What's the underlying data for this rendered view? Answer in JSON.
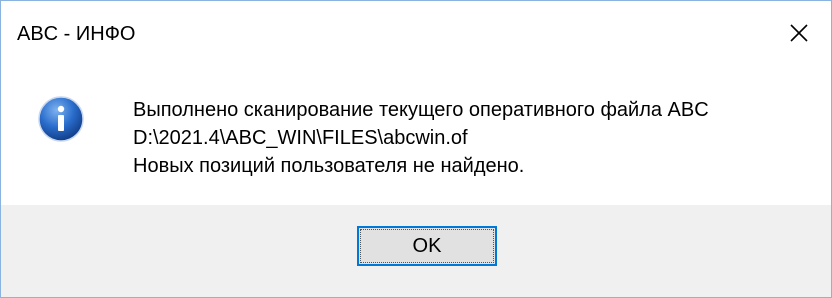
{
  "window": {
    "title": "ABC - ИНФО",
    "close_icon": "close-icon"
  },
  "message": {
    "icon": "info-icon",
    "lines": [
      "Выполнено сканирование текущего оперативного файла ABC",
      "D:\\2021.4\\ABC_WIN\\FILES\\abcwin.of",
      "Новых позиций пользователя не найдено."
    ]
  },
  "buttons": {
    "ok_label": "OK"
  },
  "colors": {
    "accent_border": "#0078d7",
    "footer_bg": "#f0f0f0",
    "icon_blue": "#1d5fb8"
  }
}
